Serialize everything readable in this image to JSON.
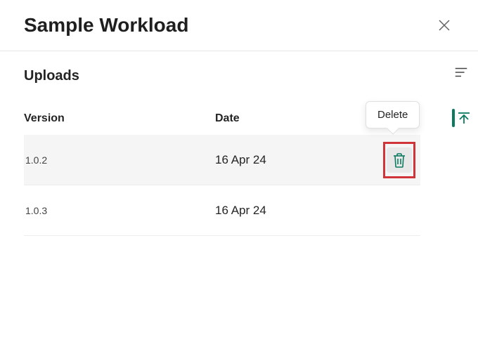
{
  "header": {
    "title": "Sample Workload"
  },
  "section": {
    "title": "Uploads"
  },
  "table": {
    "columns": {
      "version": "Version",
      "date": "Date"
    },
    "rows": [
      {
        "version": "1.0.2",
        "date": "16 Apr 24"
      },
      {
        "version": "1.0.3",
        "date": "16 Apr 24"
      }
    ]
  },
  "tooltip": {
    "delete": "Delete"
  }
}
